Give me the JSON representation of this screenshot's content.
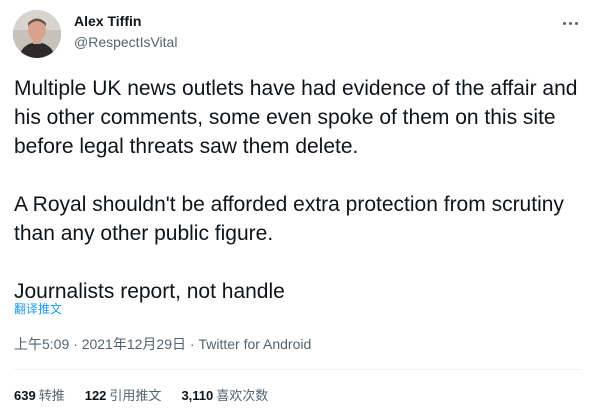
{
  "author": {
    "name": "Alex Tiffin",
    "handle": "@RespectIsVital"
  },
  "tweet": {
    "paragraphs": [
      "Multiple UK news outlets have had evidence of the affair and his other comments, some even spoke of them on this site before legal threats saw them delete.",
      "A Royal shouldn't be afforded extra protection from scrutiny than any other public figure.",
      "Journalists report, not handle"
    ],
    "translate_label": "翻译推文"
  },
  "meta": {
    "time": "上午5:09",
    "separator": "·",
    "date": "2021年12月29日",
    "source": "Twitter for Android"
  },
  "stats": [
    {
      "count": "639",
      "label": "转推"
    },
    {
      "count": "122",
      "label": "引用推文"
    },
    {
      "count": "3,110",
      "label": "喜欢次数"
    }
  ],
  "colors": {
    "text": "#0f1419",
    "secondary": "#536471",
    "link": "#1d9bf0"
  },
  "icons": {
    "more": "more-horizontal-icon"
  }
}
